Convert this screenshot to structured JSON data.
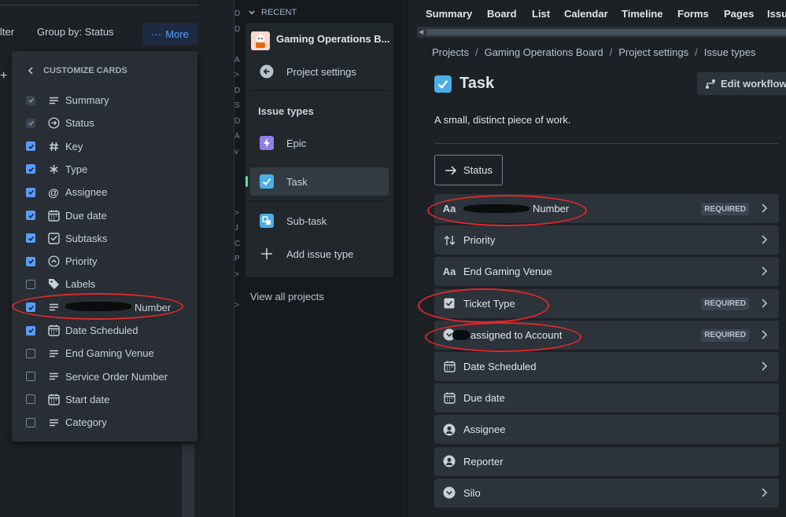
{
  "left_toolbar": {
    "filter_label": "lter",
    "group_label": "Group by: Status",
    "more_label": "More"
  },
  "customize_cards": {
    "heading": "CUSTOMIZE CARDS",
    "items": [
      {
        "label": "Summary",
        "state": "disabled-checked",
        "icon": "lines-icon"
      },
      {
        "label": "Status",
        "state": "disabled-checked",
        "icon": "arrow-circle-icon"
      },
      {
        "label": "Key",
        "state": "checked",
        "icon": "hash-icon"
      },
      {
        "label": "Type",
        "state": "checked",
        "icon": "asterisk-icon"
      },
      {
        "label": "Assignee",
        "state": "checked",
        "icon": "at-icon"
      },
      {
        "label": "Due date",
        "state": "checked",
        "icon": "calendar-icon"
      },
      {
        "label": "Subtasks",
        "state": "checked",
        "icon": "subtasks-icon"
      },
      {
        "label": "Priority",
        "state": "checked",
        "icon": "priority-icon"
      },
      {
        "label": "Labels",
        "state": "unchecked",
        "icon": "tag-icon"
      },
      {
        "label": "Number",
        "state": "checked",
        "icon": "lines-icon"
      },
      {
        "label": "Date Scheduled",
        "state": "checked",
        "icon": "calendar-icon"
      },
      {
        "label": "End Gaming Venue",
        "state": "unchecked",
        "icon": "lines-icon"
      },
      {
        "label": "Service Order Number",
        "state": "unchecked",
        "icon": "lines-icon"
      },
      {
        "label": "Start date",
        "state": "unchecked",
        "icon": "calendar-icon"
      },
      {
        "label": "Category",
        "state": "unchecked",
        "icon": "lines-icon"
      }
    ]
  },
  "sidebar": {
    "recent_label": "RECENT",
    "project_name": "Gaming Operations B...",
    "project_settings": "Project settings",
    "issue_types_heading": "Issue types",
    "issue_types": [
      {
        "label": "Epic",
        "color": "#8f7ee7",
        "icon": "epic-icon"
      },
      {
        "label": "Task",
        "color": "#4bade8",
        "icon": "task-icon"
      },
      {
        "label": "Sub-task",
        "color": "#4bade8",
        "icon": "subtask-icon"
      }
    ],
    "add_issue_type": "Add issue type",
    "view_all": "View all projects"
  },
  "topnav": {
    "tabs": [
      "Summary",
      "Board",
      "List",
      "Calendar",
      "Timeline",
      "Forms",
      "Pages",
      "Issue"
    ]
  },
  "breadcrumbs": [
    "Projects",
    "Gaming Operations Board",
    "Project settings",
    "Issue types"
  ],
  "page": {
    "title": "Task",
    "edit_workflow": "Edit workflow",
    "description": "A small, distinct piece of work.",
    "status_label": "Status"
  },
  "fields": [
    {
      "label": "Number",
      "icon": "text-field-icon",
      "required": true,
      "chevron": true
    },
    {
      "label": "Priority",
      "icon": "priority-arrows-icon",
      "required": false,
      "chevron": true
    },
    {
      "label": "End Gaming Venue",
      "icon": "text-field-icon",
      "required": false,
      "chevron": true
    },
    {
      "label": "Ticket Type",
      "icon": "checkbox-icon",
      "required": true,
      "chevron": true
    },
    {
      "label": "assigned to Account",
      "icon": "dropdown-icon",
      "required": true,
      "chevron": true
    },
    {
      "label": "Date Scheduled",
      "icon": "calendar-icon",
      "required": false,
      "chevron": true
    },
    {
      "label": "Due date",
      "icon": "calendar-icon",
      "required": false,
      "chevron": false
    },
    {
      "label": "Assignee",
      "icon": "user-icon",
      "required": false,
      "chevron": false
    },
    {
      "label": "Reporter",
      "icon": "user-icon",
      "required": false,
      "chevron": false
    },
    {
      "label": "Silo",
      "icon": "dropdown-icon",
      "required": false,
      "chevron": true
    }
  ],
  "required_label": "REQUIRED",
  "colors": {
    "accent": "#579dff",
    "annotation_red": "#e0282a",
    "background": "#1d2125"
  }
}
